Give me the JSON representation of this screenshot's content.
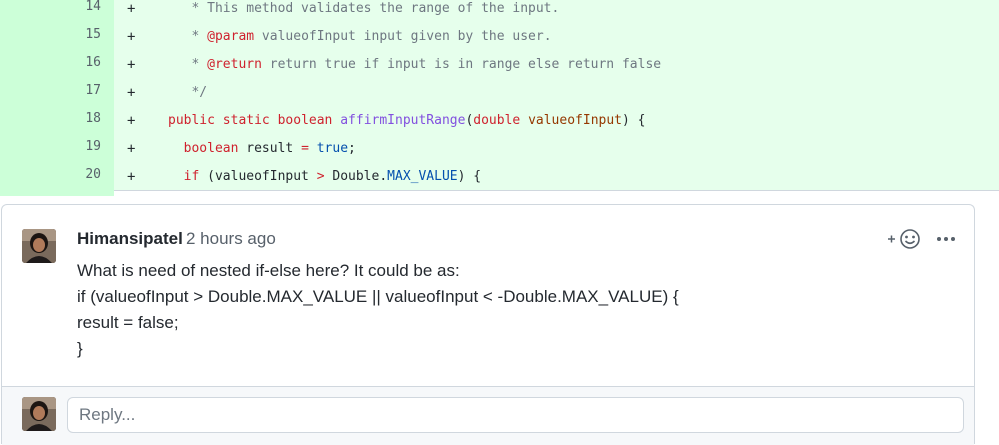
{
  "diff": {
    "lines": [
      {
        "number": "14",
        "marker": "+",
        "tokens": [
          {
            "t": "   * This method validates the range of the input.",
            "c": "tk-comment"
          }
        ]
      },
      {
        "number": "15",
        "marker": "+",
        "tokens": [
          {
            "t": "   * ",
            "c": "tk-comment"
          },
          {
            "t": "@param",
            "c": "tk-doctag"
          },
          {
            "t": " valueofInput input given by the user.",
            "c": "tk-comment"
          }
        ]
      },
      {
        "number": "16",
        "marker": "+",
        "tokens": [
          {
            "t": "   * ",
            "c": "tk-comment"
          },
          {
            "t": "@return",
            "c": "tk-doctag"
          },
          {
            "t": " return true if input is in range else return false",
            "c": "tk-comment"
          }
        ]
      },
      {
        "number": "17",
        "marker": "+",
        "tokens": [
          {
            "t": "   */",
            "c": "tk-comment"
          }
        ]
      },
      {
        "number": "18",
        "marker": "+",
        "tokens": [
          {
            "t": "public",
            "c": "tk-kw"
          },
          {
            "t": " ",
            "c": ""
          },
          {
            "t": "static",
            "c": "tk-kw"
          },
          {
            "t": " ",
            "c": ""
          },
          {
            "t": "boolean",
            "c": "tk-kw"
          },
          {
            "t": " ",
            "c": ""
          },
          {
            "t": "affirmInputRange",
            "c": "tk-fn"
          },
          {
            "t": "(",
            "c": ""
          },
          {
            "t": "double",
            "c": "tk-kw"
          },
          {
            "t": " ",
            "c": ""
          },
          {
            "t": "valueofInput",
            "c": "tk-param"
          },
          {
            "t": ") {",
            "c": ""
          }
        ]
      },
      {
        "number": "19",
        "marker": "+",
        "tokens": [
          {
            "t": "  ",
            "c": ""
          },
          {
            "t": "boolean",
            "c": "tk-kw"
          },
          {
            "t": " result ",
            "c": ""
          },
          {
            "t": "=",
            "c": "tk-op"
          },
          {
            "t": " ",
            "c": ""
          },
          {
            "t": "true",
            "c": "tk-const"
          },
          {
            "t": ";",
            "c": ""
          }
        ]
      },
      {
        "number": "20",
        "marker": "+",
        "tokens": [
          {
            "t": "  ",
            "c": ""
          },
          {
            "t": "if",
            "c": "tk-kw"
          },
          {
            "t": " (valueofInput ",
            "c": ""
          },
          {
            "t": ">",
            "c": "tk-op"
          },
          {
            "t": " Double.",
            "c": ""
          },
          {
            "t": "MAX_VALUE",
            "c": "tk-const"
          },
          {
            "t": ") {",
            "c": ""
          }
        ]
      }
    ]
  },
  "comment": {
    "author": "Himansipatel",
    "time": "2 hours ago",
    "body": [
      "What is need of nested if-else here? It could be as:",
      "if (valueofInput > Double.MAX_VALUE || valueofInput < -Double.MAX_VALUE) {",
      "result = false;",
      "}"
    ],
    "reaction_icon": "smiley-plus-icon",
    "more_icon": "kebab-horizontal-icon"
  },
  "reply": {
    "placeholder": "Reply..."
  },
  "colors": {
    "diff_add_bg": "#e6ffec",
    "diff_add_gutter": "#ccffd8",
    "keyword": "#cf222e",
    "function": "#8250df",
    "constant": "#0550ae"
  }
}
